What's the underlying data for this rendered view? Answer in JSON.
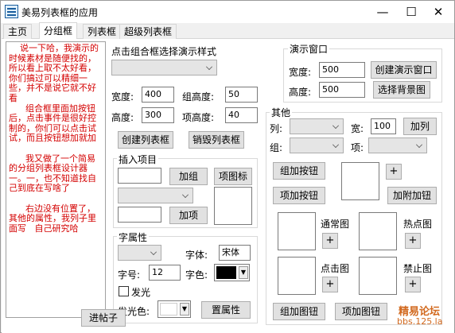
{
  "window": {
    "title": "美易列表框的应用",
    "minimize": "—",
    "maximize": "☐",
    "close": "✕"
  },
  "tabs": [
    "主页",
    "分组框",
    "列表框",
    "超级列表框"
  ],
  "memo_text": "    说一下哈，我演示的时候素材是随便找的，所以看上取不太好看，你们搞过可以精细一些，并不是说它就不好看\n      组合框里面加按钮后，点击事件是很好控制的，你们可以点击试试，而且按钮想加就加\n\n      我又做了一个简易的分组列表框设计器一。一，也不知道找自己到底在写啥了\n\n      右边没有位置了，其他的属性，我列子里面写   自己研究哈",
  "post_button": "进帖子",
  "demo_style": {
    "label": "点击组合框选择演示样式",
    "combo_value": "",
    "width_label": "宽度:",
    "width_value": "400",
    "group_height_label": "组高度:",
    "group_height_value": "50",
    "height_label": "高度:",
    "height_value": "300",
    "item_height_label": "项高度:",
    "item_height_value": "40",
    "create_listbox": "创建列表框",
    "destroy_listbox": "销毁列表框"
  },
  "insert_item": {
    "title": "插入项目",
    "group_input": "",
    "add_group": "加组",
    "item_icon": "项图标",
    "combo_value": "",
    "item_input": "",
    "add_item": "加项"
  },
  "font_attr": {
    "title": "字属性",
    "combo_value": "",
    "font_label": "字体:",
    "font_value": "宋体",
    "size_label": "字号:",
    "size_value": "12",
    "color_label": "字色:",
    "glow_label": "发光",
    "glow_color_label": "发光色:",
    "set_attr": "置属性"
  },
  "demo_window": {
    "title": "演示窗口",
    "width_label": "宽度:",
    "width_value": "500",
    "height_label": "高度:",
    "height_value": "500",
    "create_demo_window": "创建演示窗口",
    "choose_background": "选择背景图"
  },
  "other": {
    "title": "其他",
    "col_label": "列:",
    "col_value": "",
    "width_label": "宽:",
    "width_value": "100",
    "add_col": "加列",
    "group_label": "组:",
    "group_value": "",
    "item_label": "项:",
    "item_value": "",
    "group_add_button": "组加按钮",
    "item_add_button": "项加按钮",
    "attach_button": "加附加钮",
    "normal_img": "通常图",
    "hot_img": "热点图",
    "click_img": "点击图",
    "disabled_img": "禁止图",
    "group_add_image": "组加图钮",
    "item_add_image": "项加图钮",
    "plus": "+"
  },
  "watermark": {
    "line1": "精易论坛",
    "line2": "bbs.125.la"
  },
  "colors": {
    "memo_text": "#d40000",
    "watermark": "#d2691e"
  }
}
